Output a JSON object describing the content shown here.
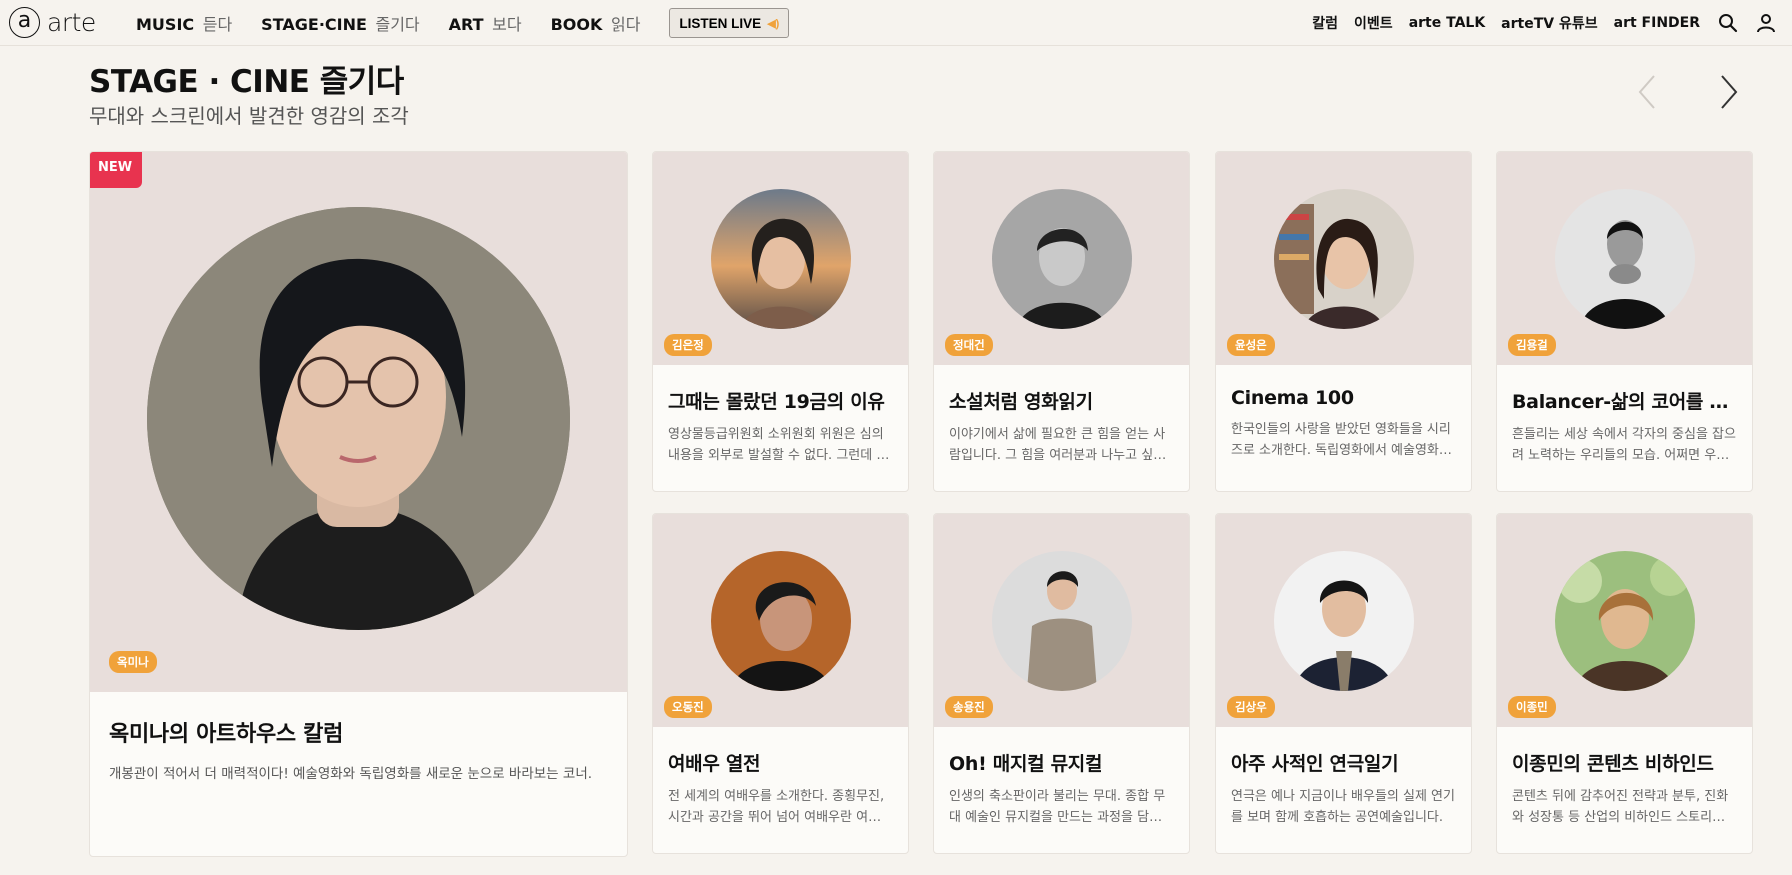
{
  "brand": {
    "mark": "a",
    "name": "arte"
  },
  "nav": {
    "items": [
      {
        "main": "MUSIC",
        "sub": "듣다"
      },
      {
        "main": "STAGE·CINE",
        "sub": "즐기다"
      },
      {
        "main": "ART",
        "sub": "보다"
      },
      {
        "main": "BOOK",
        "sub": "읽다"
      }
    ],
    "listen_live": "LISTEN LIVE"
  },
  "right_nav": [
    "칼럼",
    "이벤트",
    "arte TALK",
    "arteTV 유튜브",
    "art FINDER"
  ],
  "section": {
    "title": "STAGE · CINE 즐기다",
    "subtitle": "무대와 스크린에서 발견한 영감의 조각"
  },
  "featured": {
    "badge": "NEW",
    "author": "옥미나",
    "title": "옥미나의 아트하우스 칼럼",
    "desc": "개봉관이 적어서 더 매력적이다! 예술영화와 독립영화를 새로운 눈으로 바라보는 코너."
  },
  "cards": [
    {
      "author": "김은정",
      "title": "그때는 몰랐던 19금의 이유",
      "desc": "영상물등급위원회 소위원회 위원은 심의 내용을 외부로 발설할 수 없다. 그런데 이 칼럼에서는"
    },
    {
      "author": "정대건",
      "title": "소설처럼 영화읽기",
      "desc": "이야기에서 삶에 필요한 큰 힘을 얻는 사람입니다. 그 힘을 여러분과 나누고 싶습니다."
    },
    {
      "author": "윤성은",
      "title": "Cinema 100",
      "desc": "한국인들의 사랑을 받았던 영화들을 시리즈로 소개한다. 독립영화에서 예술영화까지"
    },
    {
      "author": "김용걸",
      "title": "Balancer-삶의 코어를 찾아서",
      "desc": "흔들리는 세상 속에서 각자의 중심을 잡으려 노력하는 우리들의 모습. 어쩌면 우리 모두가"
    },
    {
      "author": "오동진",
      "title": "여배우 열전",
      "desc": "전 세계의 여배우를 소개한다. 종횡무진, 시간과 공간을 뛰어 넘어 여배우란 여배우는 모두"
    },
    {
      "author": "송용진",
      "title": "Oh! 매지컬 뮤지컬",
      "desc": "인생의 축소판이라 불리는 무대. 종합 무대 예술인 뮤지컬을 만드는 과정을 담았다."
    },
    {
      "author": "김상우",
      "title": "아주 사적인 연극일기",
      "desc": "연극은 예나 지금이나 배우들의 실제 연기를 보며 함께 호흡하는 공연예술입니다."
    },
    {
      "author": "이종민",
      "title": "이종민의 콘텐츠 비하인드",
      "desc": "콘텐츠 뒤에 감추어진 전략과 분투, 진화와 성장통 등 산업의 비하인드 스토리를 전한다."
    }
  ]
}
